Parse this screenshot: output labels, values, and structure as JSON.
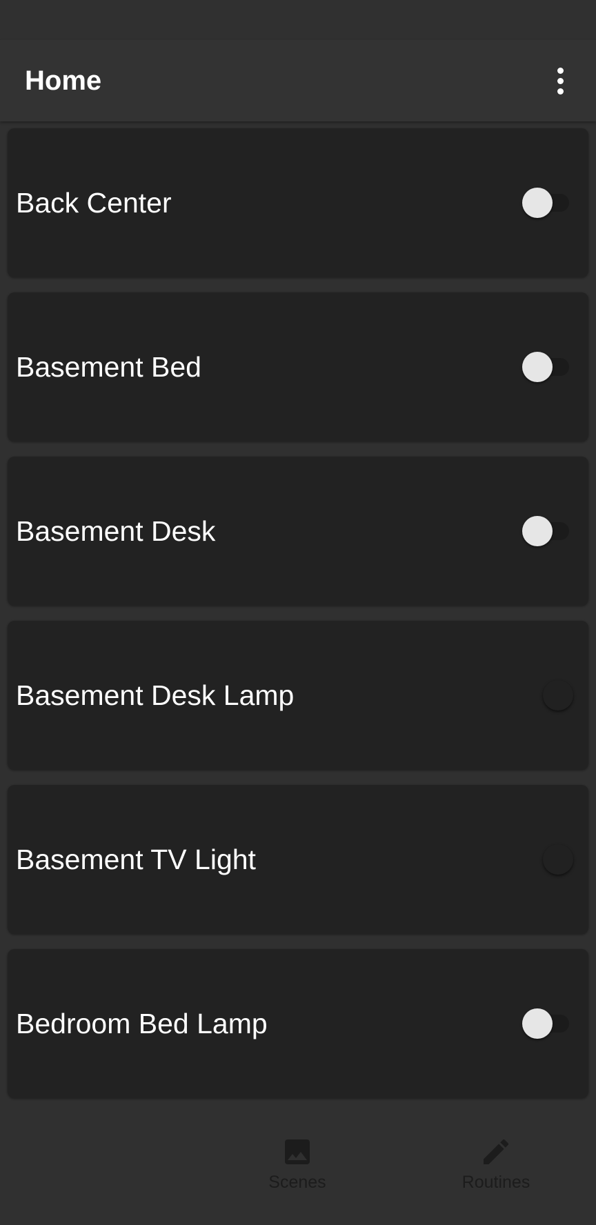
{
  "app_bar": {
    "title": "Home",
    "menu_icon": "more-vert-icon"
  },
  "devices": [
    {
      "name": "Back Center",
      "state": "off"
    },
    {
      "name": "Basement Bed",
      "state": "off"
    },
    {
      "name": "Basement Desk",
      "state": "off"
    },
    {
      "name": "Basement Desk Lamp",
      "state": "unavailable"
    },
    {
      "name": "Basement TV Light",
      "state": "unavailable"
    },
    {
      "name": "Bedroom Bed Lamp",
      "state": "off"
    }
  ],
  "bottom_nav": {
    "scenes": {
      "label": "Scenes",
      "icon": "image-icon"
    },
    "routines": {
      "label": "Routines",
      "icon": "pencil-icon"
    }
  },
  "colors": {
    "background": "#303030",
    "card": "#222222",
    "text": "#ffffff",
    "switch_thumb": "#e6e6e6"
  }
}
